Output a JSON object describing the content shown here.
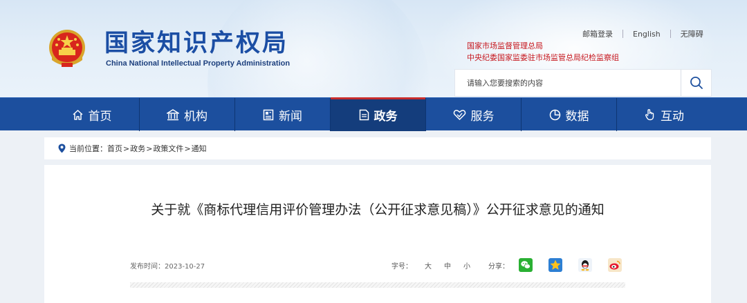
{
  "header": {
    "site_title": "国家知识产权局",
    "site_subtitle": "China National Intellectual Property Administration",
    "top_links": [
      "邮箱登录",
      "English",
      "无障碍"
    ],
    "gov_line1": "国家市场监督管理总局",
    "gov_line2": "中央纪委国家监委驻市场监管总局纪检监察组",
    "search": {
      "placeholder": "请输入您要搜索的内容"
    }
  },
  "nav": {
    "items": [
      {
        "label": "首页",
        "icon": "home-icon"
      },
      {
        "label": "机构",
        "icon": "institution-icon"
      },
      {
        "label": "新闻",
        "icon": "news-icon"
      },
      {
        "label": "政务",
        "icon": "document-icon",
        "active": true
      },
      {
        "label": "服务",
        "icon": "handshake-icon"
      },
      {
        "label": "数据",
        "icon": "pie-chart-icon"
      },
      {
        "label": "互动",
        "icon": "hand-icon"
      }
    ]
  },
  "breadcrumb": {
    "prefix": "当前位置：",
    "items": [
      "首页",
      "政务",
      "政策文件",
      "通知"
    ],
    "separator": ">"
  },
  "article": {
    "title": "关于就《商标代理信用评价管理办法（公开征求意见稿）》公开征求意见的通知",
    "date_label": "发布时间：",
    "date": "2023-10-27",
    "font_size_label": "字号：",
    "font_sizes": [
      "大",
      "中",
      "小"
    ],
    "share_label": "分享：",
    "share_targets": [
      "wechat-icon",
      "qzone-icon",
      "qq-icon",
      "weibo-icon"
    ]
  },
  "colors": {
    "brand_blue": "#1c4f9e",
    "nav_active": "#143d7c",
    "accent_red": "#c6161d"
  }
}
